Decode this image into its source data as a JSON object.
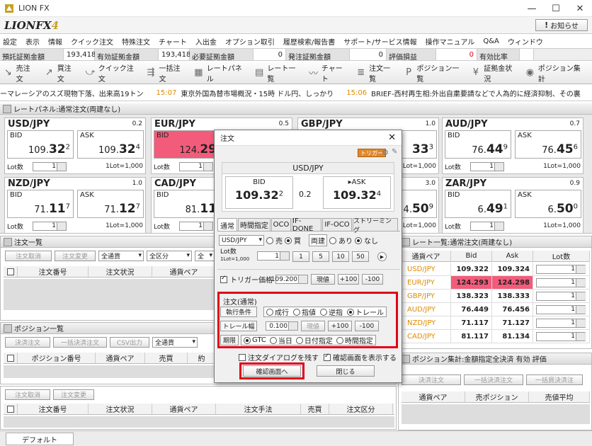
{
  "window": {
    "title": "LION FX",
    "min": "—",
    "max": "☐",
    "close": "✕"
  },
  "brand": {
    "name": "LIONFX",
    "version": "4"
  },
  "notice_label": "お知らせ",
  "menu": [
    "設定",
    "表示",
    "情報",
    "クイック注文",
    "特殊注文",
    "チャート",
    "入出金",
    "オプション取引",
    "履歴検索/報告書",
    "サポート/サービス情報",
    "操作マニュアル",
    "Q&A",
    "ウィンドウ"
  ],
  "account": [
    {
      "label": "預託証拠金額",
      "value": "193,418"
    },
    {
      "label": "有効証拠金額",
      "value": "193,418"
    },
    {
      "label": "必要証拠金額",
      "value": "0"
    },
    {
      "label": "発注証拠金額",
      "value": "0"
    },
    {
      "label": "評価損益",
      "value": "0"
    },
    {
      "label": "有効比率",
      "value": ""
    }
  ],
  "toolbar": [
    "売注文",
    "買注文",
    "クイック注文",
    "一括注文",
    "レートパネル",
    "レート一覧",
    "チャート",
    "注文一覧",
    "ポジション一覧",
    "証拠金状況",
    "ポジション集計"
  ],
  "news": [
    {
      "text": "ーマレーシアのスズ現物下落、出来高19トン",
      "time": ""
    },
    {
      "text": "東京外国為替市場概況・15時 ドル円、しっかり",
      "time": "15:07"
    },
    {
      "text": "BRIEF-西村再生相:外出自粛要請などで人為的に経済抑制、その裏",
      "time": "15:06"
    }
  ],
  "rate_panel": {
    "title": "レートパネル:通常注文(両建なし)",
    "bid_label": "BID",
    "ask_label": "ASK",
    "lot_label": "Lot数",
    "lot_unit": "1Lot=1,000",
    "tiles": [
      {
        "pair": "USD/JPY",
        "spread": "0.2",
        "bid_a": "109.",
        "bid_b": "32",
        "bid_c": "2",
        "ask_a": "109.",
        "ask_b": "32",
        "ask_c": "4",
        "lot": "1",
        "bid_hl": false
      },
      {
        "pair": "EUR/JPY",
        "spread": "0.5",
        "bid_a": "124.",
        "bid_b": "29",
        "bid_c": "",
        "ask_a": "",
        "ask_b": "",
        "ask_c": "",
        "lot": "1",
        "bid_hl": true
      },
      {
        "pair": "GBP/JPY",
        "spread": "1.0",
        "bid_a": "",
        "bid_b": "",
        "bid_c": "",
        "ask_a": "",
        "ask_b": "33",
        "ask_c": "3",
        "lot": "1",
        "bid_hl": false
      },
      {
        "pair": "AUD/JPY",
        "spread": "0.7",
        "bid_a": "76.",
        "bid_b": "44",
        "bid_c": "9",
        "ask_a": "76.",
        "ask_b": "45",
        "ask_c": "6",
        "lot": "1",
        "bid_hl": false
      },
      {
        "pair": "NZD/JPY",
        "spread": "1.0",
        "bid_a": "71.",
        "bid_b": "11",
        "bid_c": "7",
        "ask_a": "71.",
        "ask_b": "12",
        "ask_c": "7",
        "lot": "1",
        "bid_hl": false
      },
      {
        "pair": "CAD/JPY",
        "spread": "",
        "bid_a": "81.",
        "bid_b": "11",
        "bid_c": "",
        "ask_a": "",
        "ask_b": "",
        "ask_c": "",
        "lot": "1",
        "bid_hl": false
      },
      {
        "pair": "",
        "spread": "3.0",
        "bid_a": "",
        "bid_b": "",
        "bid_c": "",
        "ask_a": "4.",
        "ask_b": "50",
        "ask_c": "9",
        "lot": "1",
        "bid_hl": false
      },
      {
        "pair": "ZAR/JPY",
        "spread": "0.9",
        "bid_a": "6.",
        "bid_b": "49",
        "bid_c": "1",
        "ask_a": "6.",
        "ask_b": "50",
        "ask_c": "0",
        "lot": "1",
        "bid_hl": false
      }
    ]
  },
  "order_list": {
    "title": "注文一覧",
    "cancel": "注文取消",
    "change": "注文変更",
    "currency": "全通貨",
    "kind": "全区分",
    "more": "全",
    "cols": [
      "注文番号",
      "注文状況",
      "通貨ペア"
    ]
  },
  "position_list": {
    "title": "ポジション一覧",
    "settle": "決済注文",
    "bulk": "一括決済注文",
    "csv": "CSV出力",
    "currency": "全通貨",
    "cols": [
      "ポジション番号",
      "通貨ペア",
      "売買",
      "約"
    ]
  },
  "order_list2": {
    "cancel": "注文取消",
    "change": "注文変更",
    "cols": [
      "注文番号",
      "注文状況",
      "通貨ペア",
      "注文手法",
      "売買",
      "注文区分"
    ]
  },
  "rate_list": {
    "title": "レート一覧:通常注文(両建なし)",
    "cols": [
      "通貨ペア",
      "Bid",
      "Ask",
      "Lot数"
    ],
    "rows": [
      {
        "pair": "USD/JPY",
        "bid": "109.322",
        "ask": "109.324",
        "lot": "1",
        "hl": false
      },
      {
        "pair": "EUR/JPY",
        "bid": "124.293",
        "ask": "124.298",
        "lot": "1",
        "hl": true
      },
      {
        "pair": "GBP/JPY",
        "bid": "138.323",
        "ask": "138.333",
        "lot": "1",
        "hl": false
      },
      {
        "pair": "AUD/JPY",
        "bid": "76.449",
        "ask": "76.456",
        "lot": "1",
        "hl": false
      },
      {
        "pair": "NZD/JPY",
        "bid": "71.117",
        "ask": "71.127",
        "lot": "1",
        "hl": false
      },
      {
        "pair": "CAD/JPY",
        "bid": "81.117",
        "ask": "81.134",
        "lot": "1",
        "hl": false
      }
    ]
  },
  "pos_summary": {
    "title": "ポジション集計:金額指定全決済 有効 評価",
    "settle": "決済注文",
    "bulk": "一括決済注文",
    "bulk2": "一括買決済注",
    "cols": [
      "通貨ペア",
      "売ポジション",
      "売値平均"
    ]
  },
  "footer_tab": "デフォルト",
  "dialog": {
    "title": "注文",
    "trigger_badge": "トリガー",
    "pair": "USD/JPY",
    "bid_label": "BID",
    "ask_label": "▸ASK",
    "bid_a": "109.32",
    "bid_b": "2",
    "ask_a": "109.32",
    "ask_b": "4",
    "spread": "0.2",
    "tabs": [
      "通常",
      "時間指定",
      "OCO",
      "IF-DONE",
      "IF-OCO",
      "ストリーミング"
    ],
    "pair_select": "USD/JPY",
    "sell": "売",
    "buy": "買",
    "hedge_label": "両建",
    "hedge_yes": "あり",
    "hedge_no": "なし",
    "lot_label": "Lot数",
    "lot_unit": "1Lot=1,000",
    "lot_value": "1",
    "lot_btns": [
      "1",
      "5",
      "10",
      "50"
    ],
    "trigger_label": "トリガー価格",
    "trigger_value": "109.200",
    "current_btn": "現値",
    "plus_btn": "+100",
    "minus_btn": "-100",
    "section_title": "注文(通常)",
    "exec_label": "執行条件",
    "exec_options": [
      "成行",
      "指値",
      "逆指",
      "トレール"
    ],
    "trail_label": "トレール幅",
    "trail_value": "0.100",
    "trail_current": "現値",
    "trail_plus": "+100",
    "trail_minus": "-100",
    "period_label": "期限",
    "period_options": [
      "GTC",
      "当日",
      "日付指定",
      "時間指定"
    ],
    "keep_dialog": "注文ダイアログを残す",
    "show_confirm": "確認画面を表示する",
    "confirm_btn": "確認画面へ",
    "close_btn": "閉じる"
  }
}
